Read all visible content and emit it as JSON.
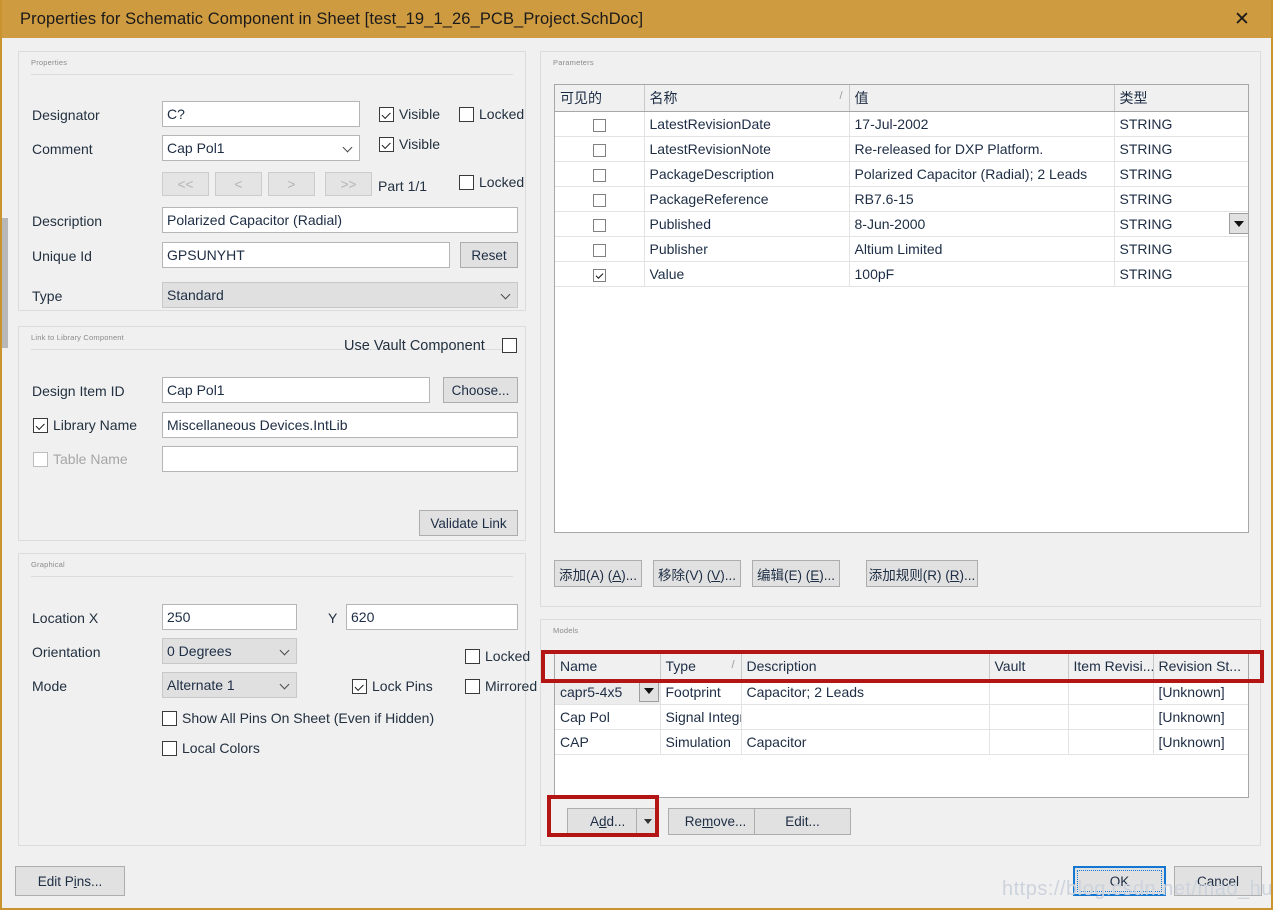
{
  "window": {
    "title": "Properties for Schematic Component in Sheet [test_19_1_26_PCB_Project.SchDoc]",
    "close_icon": "close-icon",
    "titlebar_color": "#cf9b41",
    "accent_red": "#b31515",
    "focus_blue": "#1477d1"
  },
  "properties": {
    "group_label": "Properties",
    "designator": {
      "label": "Designator",
      "value": "C?",
      "visible_label": "Visible",
      "visible_checked": true,
      "locked_label": "Locked",
      "locked_checked": false
    },
    "comment": {
      "label": "Comment",
      "value": "Cap Pol1",
      "visible_label": "Visible",
      "visible_checked": true
    },
    "nav": {
      "first": "<<",
      "prev": "<",
      "next": ">",
      "last": ">>",
      "part_label": "Part 1/1",
      "locked_label": "Locked",
      "locked_checked": false
    },
    "description": {
      "label": "Description",
      "value": "Polarized Capacitor (Radial)"
    },
    "unique_id": {
      "label": "Unique Id",
      "value": "GPSUNYHT",
      "reset_label": "Reset"
    },
    "type": {
      "label": "Type",
      "value": "Standard"
    }
  },
  "link_library": {
    "group_label": "Link to Library Component",
    "use_vault_label": "Use Vault Component",
    "use_vault_checked": false,
    "design_item_id": {
      "label": "Design Item ID",
      "value": "Cap Pol1",
      "choose_label": "Choose..."
    },
    "library_name": {
      "label": "Library Name",
      "checked": true,
      "value": "Miscellaneous Devices.IntLib"
    },
    "table_name": {
      "label": "Table Name",
      "checked": false,
      "value": "",
      "disabled": true
    },
    "validate_label": "Validate Link"
  },
  "graphical": {
    "group_label": "Graphical",
    "location": {
      "label": "Location  X",
      "x": "250",
      "y_label": "Y",
      "y": "620"
    },
    "orientation": {
      "label": "Orientation",
      "value": "0 Degrees"
    },
    "mode": {
      "label": "Mode",
      "value": "Alternate 1"
    },
    "locked": {
      "label": "Locked",
      "checked": false
    },
    "lock_pins": {
      "label": "Lock Pins",
      "checked": true
    },
    "mirrored": {
      "label": "Mirrored",
      "checked": false
    },
    "show_all_pins": {
      "label": "Show All Pins On Sheet (Even if Hidden)",
      "checked": false
    },
    "local_colors": {
      "label": "Local Colors",
      "checked": false
    }
  },
  "parameters": {
    "group_label": "Parameters",
    "columns": [
      "可见的",
      "名称",
      "值",
      "类型"
    ],
    "sort_column_index": 1,
    "sort_mark": "/",
    "rows": [
      {
        "visible": false,
        "name": "LatestRevisionDate",
        "value": "17-Jul-2002",
        "type": "STRING",
        "dropdown": false
      },
      {
        "visible": false,
        "name": "LatestRevisionNote",
        "value": "Re-released for DXP Platform.",
        "type": "STRING",
        "dropdown": false
      },
      {
        "visible": false,
        "name": "PackageDescription",
        "value": "Polarized Capacitor (Radial); 2 Leads",
        "type": "STRING",
        "dropdown": false
      },
      {
        "visible": false,
        "name": "PackageReference",
        "value": "RB7.6-15",
        "type": "STRING",
        "dropdown": false
      },
      {
        "visible": false,
        "name": "Published",
        "value": "8-Jun-2000",
        "type": "STRING",
        "dropdown": true
      },
      {
        "visible": false,
        "name": "Publisher",
        "value": "Altium Limited",
        "type": "STRING",
        "dropdown": false
      },
      {
        "visible": true,
        "name": "Value",
        "value": "100pF",
        "type": "STRING",
        "dropdown": false
      }
    ],
    "buttons": [
      {
        "name": "add-parameter-button",
        "pre": "添加(A) (",
        "mnemonic": "A",
        "post": ")..."
      },
      {
        "name": "remove-parameter-button",
        "pre": "移除(V) (",
        "mnemonic": "V",
        "post": ")..."
      },
      {
        "name": "edit-parameter-button",
        "pre": "编辑(E) (",
        "mnemonic": "E",
        "post": ")..."
      },
      {
        "name": "add-rule-button",
        "pre": "添加规则(R) (",
        "mnemonic": "R",
        "post": ")..."
      }
    ]
  },
  "models": {
    "group_label": "Models",
    "columns": [
      "Name",
      "Type",
      "Description",
      "Vault",
      "Item Revisi...",
      "Revision St..."
    ],
    "sort_column_index": 1,
    "sort_mark": "/",
    "rows": [
      {
        "name": "capr5-4x5",
        "type": "Footprint",
        "description": "Capacitor; 2 Leads",
        "vault": "",
        "item_revision": "",
        "revision_status": "[Unknown]",
        "dropdown": true
      },
      {
        "name": "Cap Pol",
        "type": "Signal Integri",
        "description": "",
        "vault": "",
        "item_revision": "",
        "revision_status": "[Unknown]",
        "dropdown": false
      },
      {
        "name": "CAP",
        "type": "Simulation",
        "description": "Capacitor",
        "vault": "",
        "item_revision": "",
        "revision_status": "[Unknown]",
        "dropdown": false
      }
    ],
    "buttons": {
      "add": {
        "pre": "A",
        "mnemonic": "d",
        "post": "d...",
        "has_split_arrow": true
      },
      "remove": {
        "pre": "Re",
        "mnemonic": "m",
        "post": "ove..."
      },
      "edit": {
        "pre": "Edit...",
        "mnemonic": "",
        "post": ""
      }
    }
  },
  "footer": {
    "edit_pins": {
      "pre": "Edit P",
      "mnemonic": "i",
      "post": "ns..."
    },
    "ok": "OK",
    "cancel": "Cancel"
  },
  "watermark": "https://blog.csdn.net/mao_hui_fei"
}
